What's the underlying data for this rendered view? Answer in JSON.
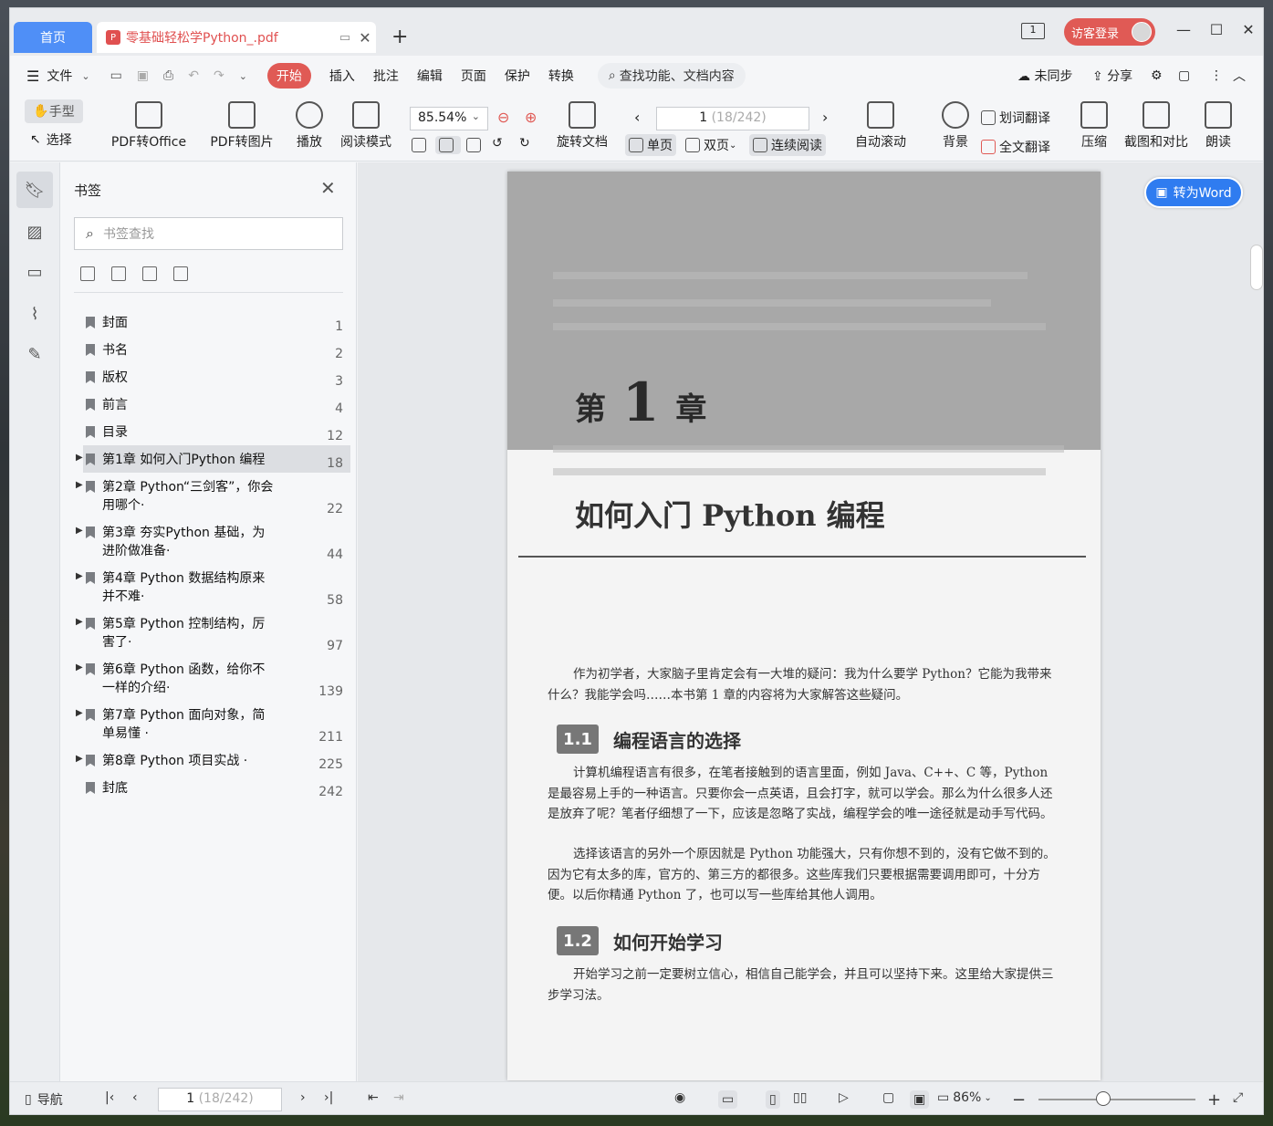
{
  "tabs": {
    "home": "首页",
    "doc_title": "零基础轻松学Python_.pdf"
  },
  "header": {
    "guest_login": "访客登录"
  },
  "menu": {
    "file": "文件",
    "items": [
      "开始",
      "插入",
      "批注",
      "编辑",
      "页面",
      "保护",
      "转换"
    ],
    "search_placeholder": "查找功能、文档内容",
    "sync": "未同步",
    "share": "分享"
  },
  "ribbon": {
    "hand": "手型",
    "select": "选择",
    "pdf_to_office": "PDF转Office",
    "pdf_to_image": "PDF转图片",
    "play": "播放",
    "read_mode": "阅读模式",
    "zoom": "85.54%",
    "rotate_doc": "旋转文档",
    "page_current": "1",
    "page_total": "(18/242)",
    "single_page": "单页",
    "double_page": "双页",
    "continuous": "连续阅读",
    "auto_scroll": "自动滚动",
    "background": "背景",
    "word_translate": "划词翻译",
    "full_translate": "全文翻译",
    "compress": "压缩",
    "screenshot_compare": "截图和对比",
    "read_aloud": "朗读"
  },
  "bookmarks": {
    "title": "书签",
    "search_placeholder": "书签查找",
    "items": [
      {
        "label": "封面",
        "page": "1",
        "expandable": false
      },
      {
        "label": "书名",
        "page": "2",
        "expandable": false
      },
      {
        "label": "版权",
        "page": "3",
        "expandable": false
      },
      {
        "label": "前言",
        "page": "4",
        "expandable": false
      },
      {
        "label": "目录",
        "page": "12",
        "expandable": false
      },
      {
        "label": "第1章 如何入门Python 编程",
        "page": "18",
        "expandable": true,
        "selected": true
      },
      {
        "label": "第2章 Python“三剑客”，你会用哪个·",
        "page": "22",
        "expandable": true
      },
      {
        "label": "第3章 夯实Python 基础，为进阶做准备·",
        "page": "44",
        "expandable": true
      },
      {
        "label": "第4章 Python 数据结构原来并不难·",
        "page": "58",
        "expandable": true
      },
      {
        "label": "第5章 Python 控制结构，厉害了·",
        "page": "97",
        "expandable": true
      },
      {
        "label": "第6章 Python 函数，给你不一样的介绍·",
        "page": "139",
        "expandable": true
      },
      {
        "label": "第7章 Python 面向对象，简单易懂 ·",
        "page": "211",
        "expandable": true
      },
      {
        "label": "第8章 Python 项目实战 ·",
        "page": "225",
        "expandable": true
      },
      {
        "label": "封底",
        "page": "242",
        "expandable": false
      }
    ]
  },
  "document": {
    "chapter_prefix": "第",
    "chapter_num": "1",
    "chapter_suffix": "章",
    "chapter_title": "如何入门 Python 编程",
    "intro": "作为初学者，大家脑子里肯定会有一大堆的疑问：我为什么要学 Python？它能为我带来什么？我能学会吗……本书第 1 章的内容将为大家解答这些疑问。",
    "s1_num": "1.1",
    "s1_title": "编程语言的选择",
    "s1_p1": "计算机编程语言有很多，在笔者接触到的语言里面，例如 Java、C++、C 等，Python 是最容易上手的一种语言。只要你会一点英语，且会打字，就可以学会。那么为什么很多人还是放弃了呢？笔者仔细想了一下，应该是忽略了实战，编程学会的唯一途径就是动手写代码。",
    "s1_p2": "选择该语言的另外一个原因就是 Python 功能强大，只有你想不到的，没有它做不到的。因为它有太多的库，官方的、第三方的都很多。这些库我们只要根据需要调用即可，十分方便。以后你精通 Python 了，也可以写一些库给其他人调用。",
    "s2_num": "1.2",
    "s2_title": "如何开始学习",
    "s2_p1": "开始学习之前一定要树立信心，相信自己能学会，并且可以坚持下来。这里给大家提供三步学习法。",
    "to_word": "转为Word"
  },
  "status": {
    "nav": "导航",
    "page_current": "1",
    "page_total": "(18/242)",
    "zoom": "86%"
  }
}
